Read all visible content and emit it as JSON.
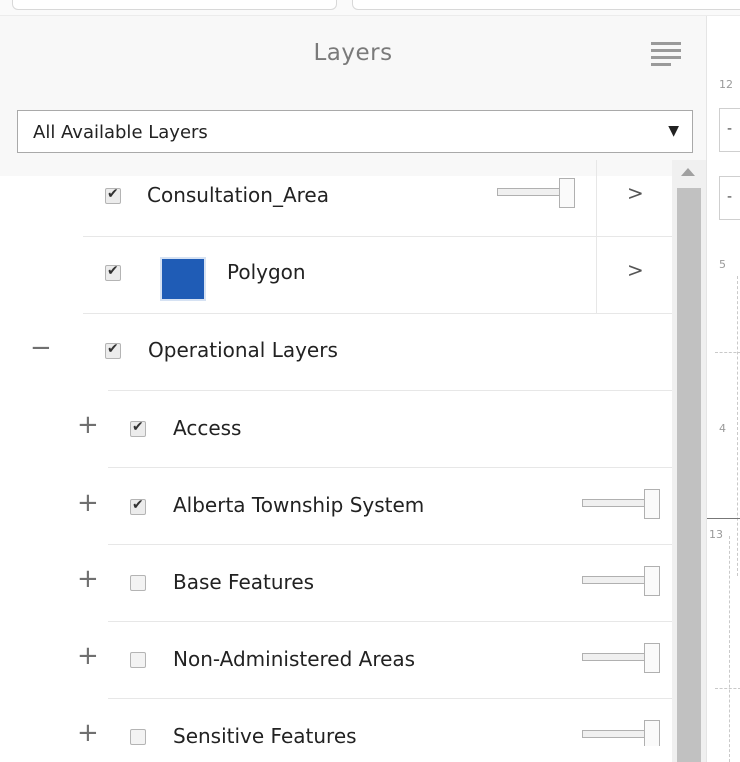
{
  "panel": {
    "title": "Layers",
    "menu_icon": "hamburger-icon",
    "select": {
      "value": "All Available Layers",
      "arrow": "▼"
    }
  },
  "rows": [
    {
      "label": "Consultation_Area",
      "checked": true,
      "arrow": ">",
      "slider": "opacity-slider"
    },
    {
      "label": "Polygon",
      "checked": true,
      "arrow": ">",
      "swatch_color": "#1f5cb6"
    },
    {
      "label": "Operational Layers",
      "checked": true,
      "expander": "−"
    },
    {
      "label": "Access",
      "checked": true,
      "expander": "+"
    },
    {
      "label": "Alberta Township System",
      "checked": true,
      "expander": "+",
      "slider": "opacity-slider"
    },
    {
      "label": "Base Features",
      "checked": false,
      "expander": "+",
      "slider": "opacity-slider"
    },
    {
      "label": "Non-Administered Areas",
      "checked": false,
      "expander": "+",
      "slider": "opacity-slider"
    },
    {
      "label": "Sensitive Features",
      "checked": false,
      "expander": "+",
      "slider": "opacity-slider"
    }
  ],
  "map": {
    "labels": [
      "12",
      "5",
      "4",
      "13"
    ],
    "buttons": [
      "-",
      "-"
    ]
  },
  "colors": {
    "header_bg": "#f8f8f8",
    "swatch": "#1f5cb6",
    "scroll_thumb": "#c1c1c1"
  }
}
